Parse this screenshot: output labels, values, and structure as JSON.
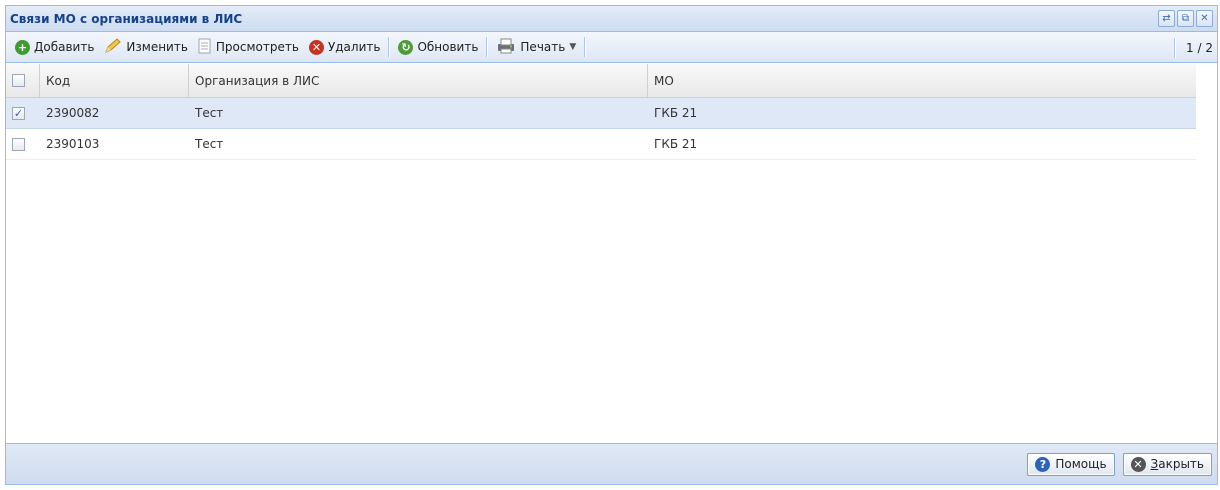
{
  "window": {
    "title": "Связи МО с организациями в ЛИС",
    "tools": [
      {
        "icon": "refresh-icon",
        "glyph": "⇄"
      },
      {
        "icon": "restore-icon",
        "glyph": "⧉"
      },
      {
        "icon": "close-icon",
        "glyph": "✕"
      }
    ]
  },
  "toolbar": {
    "add_label": "Добавить",
    "edit_label": "Изменить",
    "view_label": "Просмотреть",
    "delete_label": "Удалить",
    "refresh_label": "Обновить",
    "print_label": "Печать",
    "pager": "1 / 2"
  },
  "colors": {
    "add": "#3f9b32",
    "delete": "#c8321f",
    "refresh": "#4f9a3a",
    "help": "#2e63b8",
    "close": "#555555"
  },
  "grid": {
    "columns": [
      "Код",
      "Организация в ЛИС",
      "МО"
    ],
    "rows": [
      {
        "code": "2390082",
        "org": "Тест",
        "mo": "ГКБ 21",
        "checked": true
      },
      {
        "code": "2390103",
        "org": "Тест",
        "mo": "ГКБ 21",
        "checked": false
      }
    ]
  },
  "footer": {
    "help_label": "Помощь",
    "close_label_first": "З",
    "close_label_rest": "акрыть"
  }
}
